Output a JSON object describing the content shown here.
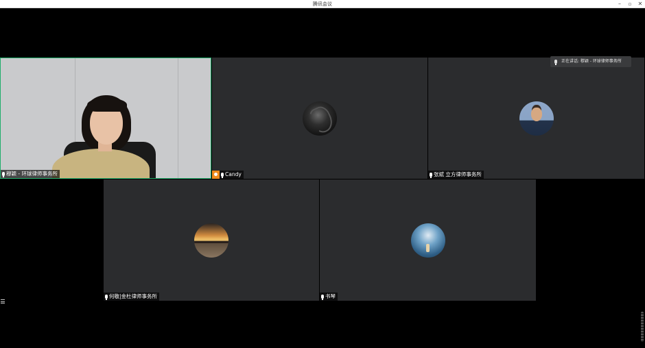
{
  "window": {
    "title": "腾讯会议",
    "minimize_glyph": "–",
    "maximize_glyph": "▫",
    "close_glyph": "✕"
  },
  "speaking_indicator": {
    "text": "正在讲话: 穆颖 - 环球律师事务所"
  },
  "participants": [
    {
      "name": "穆颖 - 环球律师事务所",
      "video": "camera",
      "active": true
    },
    {
      "name": "Candy",
      "video": "avatar",
      "avatar_icon": "dark-portrait-avatar",
      "host": true
    },
    {
      "name": "张斌 立方律师事务所",
      "video": "avatar",
      "avatar_icon": "man-portrait-avatar"
    },
    {
      "name": "何敬|金杜律师事务所",
      "video": "avatar",
      "avatar_icon": "sunset-avatar"
    },
    {
      "name": "书琴",
      "video": "avatar",
      "avatar_icon": "waterfall-avatar"
    }
  ],
  "colors": {
    "active_border": "#1fae6a",
    "tile_background": "#2b2c2e",
    "host_badge": "#f08c1c",
    "page_background": "#000000"
  }
}
